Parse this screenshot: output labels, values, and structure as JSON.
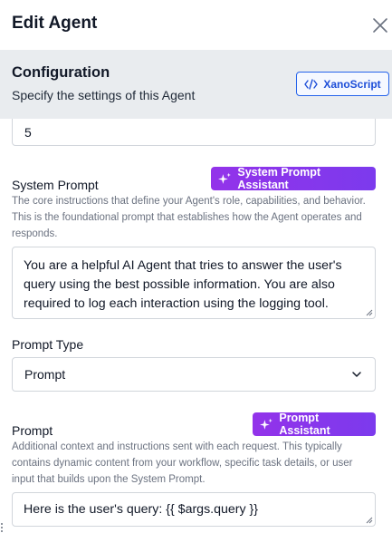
{
  "header": {
    "title": "Edit Agent"
  },
  "config": {
    "title": "Configuration",
    "subtitle": "Specify the settings of this Agent",
    "xanoscript_label": "XanoScript"
  },
  "fields": {
    "top_value": "5",
    "system_prompt": {
      "label": "System Prompt",
      "help": "The core instructions that define your Agent's role, capabilities, and behavior. This is the foundational prompt that establishes how the Agent operates and responds.",
      "assistant_label": "System Prompt Assistant",
      "value": "You are a helpful AI Agent that tries to answer the user's query using the best possible information. You are also required to log each interaction using the logging tool."
    },
    "prompt_type": {
      "label": "Prompt Type",
      "selected": "Prompt"
    },
    "prompt": {
      "label": "Prompt",
      "help": "Additional context and instructions sent with each request. This typically contains dynamic content from your workflow, specific task details, or user input that builds upon the System Prompt.",
      "assistant_label": "Prompt Assistant",
      "value": "Here is the user's query: {{ $args.query }}"
    }
  },
  "colors": {
    "accent_blue": "#2563eb",
    "ai_purple": "#9333ea",
    "section_bg": "#e9ecef"
  },
  "icons": [
    "close-icon",
    "code-icon",
    "sparkle-icon",
    "chevron-down-icon",
    "resize-handle-icon"
  ]
}
